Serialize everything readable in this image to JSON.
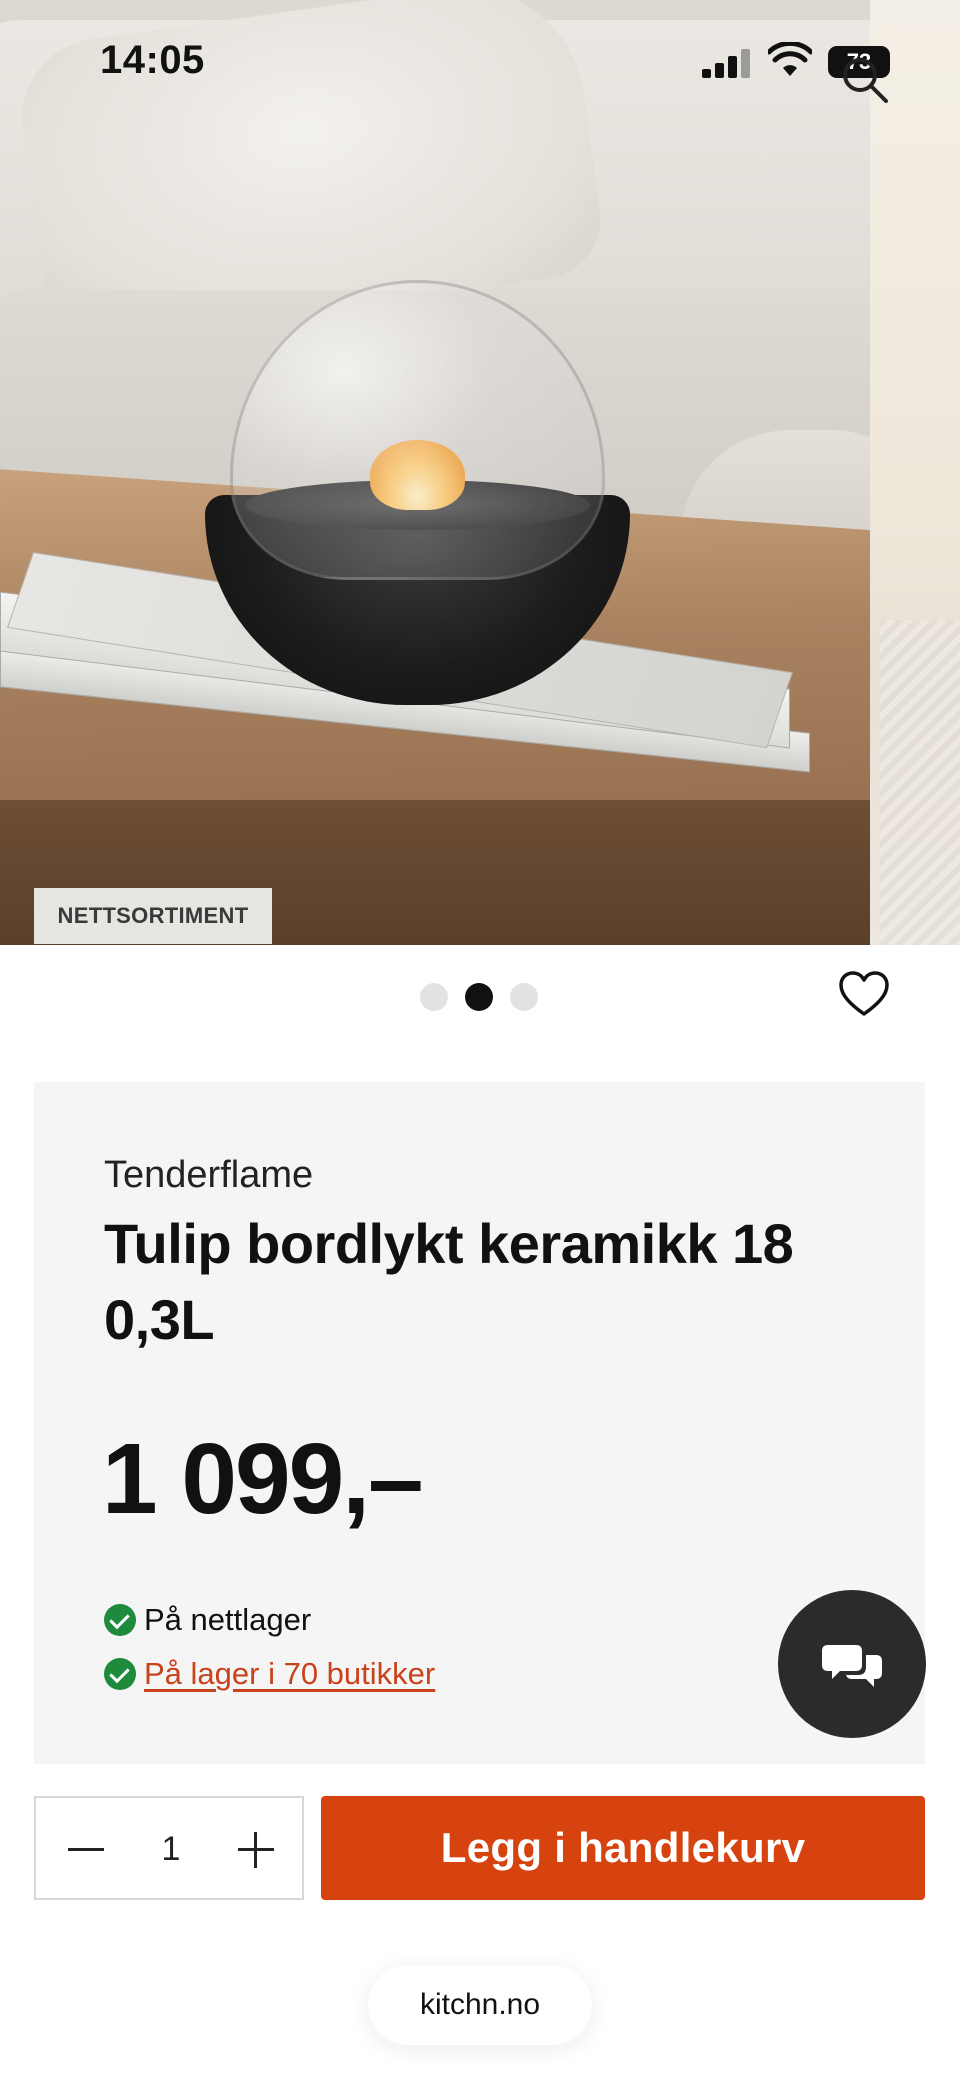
{
  "status_bar": {
    "time": "14:05",
    "battery": "73"
  },
  "hero": {
    "badge": "NETTSORTIMENT",
    "carousel": {
      "total": 3,
      "active_index": 1
    }
  },
  "product": {
    "brand": "Tenderflame",
    "title": "Tulip bordlykt keramikk 18 0,3L",
    "price": "1 099,–",
    "stock_online": "På nettlager",
    "stock_stores": "På lager i 70 butikker"
  },
  "cart": {
    "quantity": "1",
    "add_label": "Legg i handlekurv"
  },
  "browser": {
    "url": "kitchn.no"
  },
  "colors": {
    "accent": "#d7430f",
    "link": "#c8431b",
    "in_stock": "#1e8a3c",
    "card_bg": "#f5f5f5"
  },
  "icons": [
    "search-icon",
    "heart-icon",
    "chat-icon",
    "check-icon",
    "minus-icon",
    "plus-icon",
    "signal-icon",
    "wifi-icon",
    "battery-icon"
  ]
}
